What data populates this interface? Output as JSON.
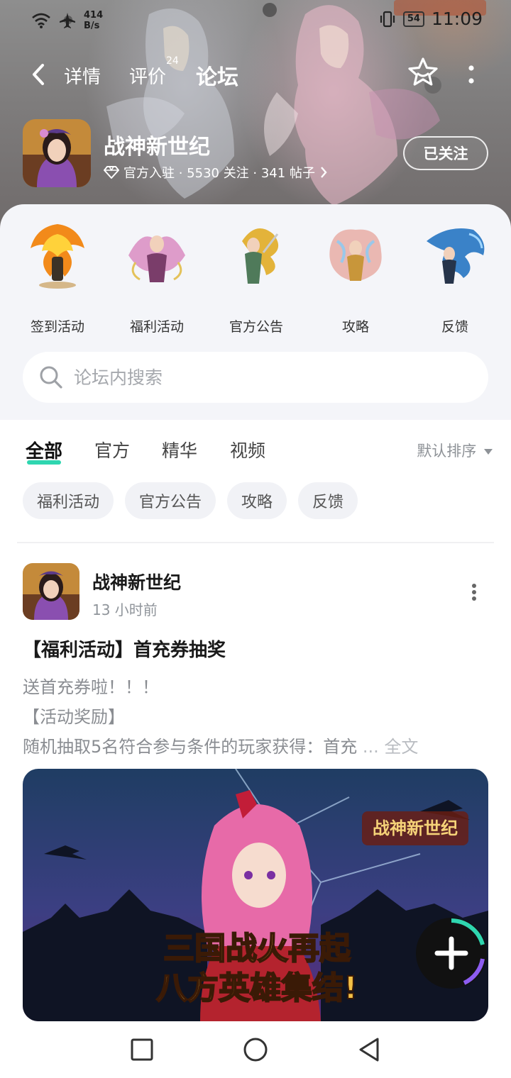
{
  "status_bar": {
    "net_speed": "414",
    "net_unit": "B/s",
    "battery": "54",
    "time": "11:09"
  },
  "nav": {
    "tabs": [
      {
        "label": "详情"
      },
      {
        "label": "评价",
        "badge": "24"
      },
      {
        "label": "论坛"
      }
    ]
  },
  "game": {
    "name": "战神新世纪",
    "meta": "官方入驻 · 5530 关注 · 341 帖子",
    "follow_label": "已关注"
  },
  "shortcuts": [
    {
      "label": "签到活动"
    },
    {
      "label": "福利活动"
    },
    {
      "label": "官方公告"
    },
    {
      "label": "攻略"
    },
    {
      "label": "反馈"
    }
  ],
  "search": {
    "placeholder": "论坛内搜索"
  },
  "filter_tabs": [
    {
      "label": "全部"
    },
    {
      "label": "官方"
    },
    {
      "label": "精华"
    },
    {
      "label": "视频"
    }
  ],
  "sort_label": "默认排序",
  "chips": [
    {
      "label": "福利活动"
    },
    {
      "label": "官方公告"
    },
    {
      "label": "攻略"
    },
    {
      "label": "反馈"
    }
  ],
  "post": {
    "author": "战神新世纪",
    "time": "13 小时前",
    "title": "【福利活动】首充券抽奖",
    "lines": [
      "送首充券啦！！！",
      "【活动奖励】",
      "随机抽取5名符合参与条件的玩家获得：首充"
    ],
    "ellipsis": " ... ",
    "more_label": "全文",
    "image_logo": "战神新世纪",
    "image_text_line1": "三国战火再起",
    "image_text_line2": "八方英雄集结!"
  },
  "colors": {
    "accent": "#2fd6b0",
    "sheet_bg": "#f4f5f9"
  }
}
